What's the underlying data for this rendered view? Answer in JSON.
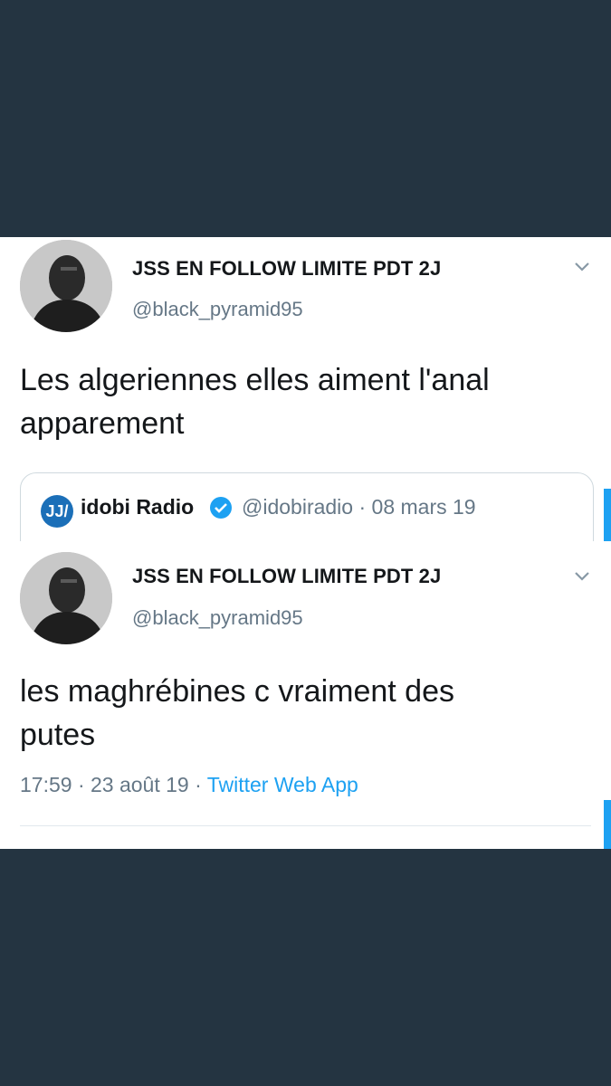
{
  "tweet1": {
    "display_name": "JSS EN FOLLOW LIMITE PDT 2J",
    "handle": "@black_pyramid95",
    "text_line1": "Les algeriennes elles aiment l'anal",
    "text_line2": "apparement",
    "quoted": {
      "logo_text": "JJ/",
      "name": "idobi Radio",
      "handle_date": "@idobiradio · 08 mars 19"
    }
  },
  "tweet2": {
    "display_name": "JSS EN FOLLOW LIMITE PDT 2J",
    "handle": "@black_pyramid95",
    "text_line1": "les maghrébines c vraiment des",
    "text_line2": "putes",
    "time_date": "17:59 · 23 août 19 · ",
    "source": "Twitter Web App"
  },
  "colors": {
    "background": "#243441",
    "card": "#ffffff",
    "accent": "#1da1f2",
    "secondary_text": "#657786"
  },
  "icons": {
    "chevron": "chevron-down-icon",
    "verified": "verified-badge-icon"
  }
}
